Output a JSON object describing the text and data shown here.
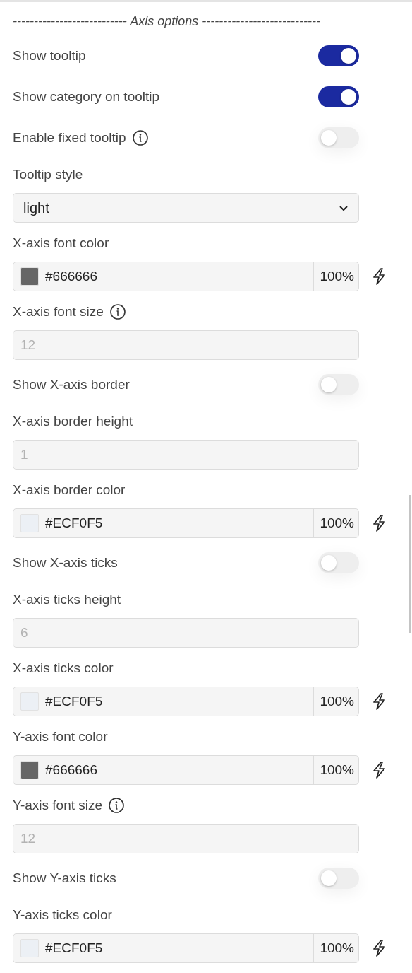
{
  "section_title": "--------------------------- Axis options ----------------------------",
  "items": [
    {
      "kind": "toggle",
      "label": "Show tooltip",
      "info": false,
      "on": true
    },
    {
      "kind": "toggle",
      "label": "Show category on tooltip",
      "info": false,
      "on": true
    },
    {
      "kind": "toggle",
      "label": "Enable fixed tooltip",
      "info": true,
      "on": false
    },
    {
      "kind": "select",
      "label": "Tooltip style",
      "info": false,
      "value": "light"
    },
    {
      "kind": "color",
      "label": "X-axis font color",
      "info": false,
      "color": "#666666",
      "value": "#666666",
      "opacity": "100%"
    },
    {
      "kind": "number",
      "label": "X-axis font size",
      "info": true,
      "placeholder": "12"
    },
    {
      "kind": "toggle",
      "label": "Show X-axis border",
      "info": false,
      "on": false
    },
    {
      "kind": "number",
      "label": "X-axis border height",
      "info": false,
      "placeholder": "1"
    },
    {
      "kind": "color",
      "label": "X-axis border color",
      "info": false,
      "color": "#ecf0f5",
      "value": "#ECF0F5",
      "opacity": "100%"
    },
    {
      "kind": "toggle",
      "label": "Show X-axis ticks",
      "info": false,
      "on": false
    },
    {
      "kind": "number",
      "label": "X-axis ticks height",
      "info": false,
      "placeholder": "6"
    },
    {
      "kind": "color",
      "label": "X-axis ticks color",
      "info": false,
      "color": "#ecf0f5",
      "value": "#ECF0F5",
      "opacity": "100%"
    },
    {
      "kind": "color",
      "label": "Y-axis font color",
      "info": false,
      "color": "#666666",
      "value": "#666666",
      "opacity": "100%"
    },
    {
      "kind": "number",
      "label": "Y-axis font size",
      "info": true,
      "placeholder": "12"
    },
    {
      "kind": "toggle",
      "label": "Show Y-axis ticks",
      "info": false,
      "on": false
    },
    {
      "kind": "color",
      "label": "Y-axis ticks color",
      "info": false,
      "color": "#ecf0f5",
      "value": "#ECF0F5",
      "opacity": "100%"
    }
  ]
}
